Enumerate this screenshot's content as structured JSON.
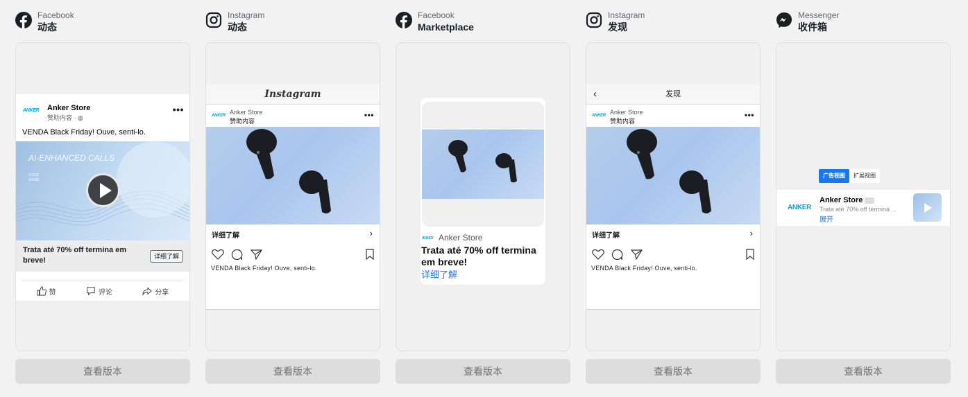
{
  "columns": [
    {
      "platform": "Facebook",
      "placement": "动态",
      "view_button": "查看版本"
    },
    {
      "platform": "Instagram",
      "placement": "动态",
      "view_button": "查看版本"
    },
    {
      "platform": "Facebook",
      "placement": "Marketplace",
      "view_button": "查看版本"
    },
    {
      "platform": "Instagram",
      "placement": "发现",
      "view_button": "查看版本"
    },
    {
      "platform": "Messenger",
      "placement": "收件箱",
      "view_button": "查看版本"
    }
  ],
  "ad": {
    "brand_logo": "ANKER",
    "store_name": "Anker Store",
    "sponsored": "赞助内容",
    "primary_text": "VENDA Black Friday! Ouve, senti-lo.",
    "headline": "Trata até 70% off termina em breve!",
    "cta": "详细了解",
    "video_overlay_title": "AI-ENHANCED CALLS",
    "video_overlay_lines": [
      "VOICE",
      "NOISE"
    ]
  },
  "fb_feed": {
    "like": "赞",
    "comment": "评论",
    "share": "分享"
  },
  "ig_feed": {
    "app_title": "Instagram"
  },
  "ig_explore": {
    "bar_title": "发现"
  },
  "messenger": {
    "tab_ad_view": "广告视图",
    "tab_expanded_view": "扩展视图",
    "desc": "Trata até 70% off termina ...",
    "expand": "展开"
  },
  "colors": {
    "facebook_blue": "#1877f2",
    "anker_blue": "#00a6e6",
    "background": "#f2f2f2",
    "button_gray": "#dddddd"
  }
}
